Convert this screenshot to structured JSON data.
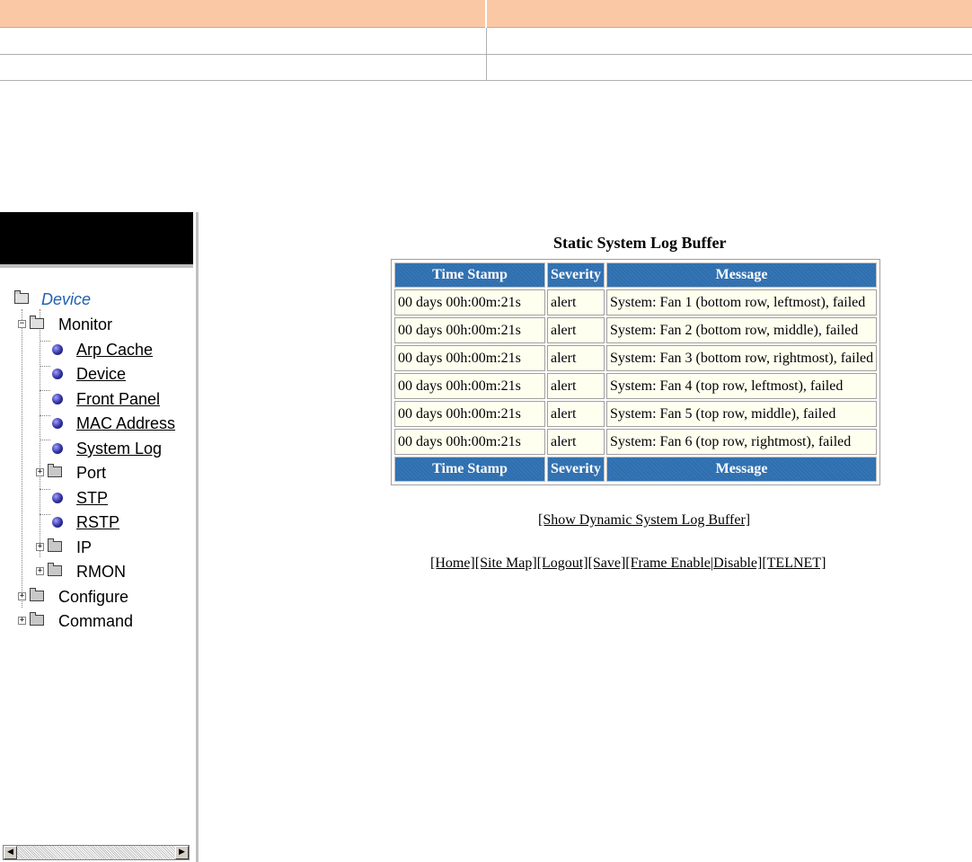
{
  "doc_table": {
    "rows": 3
  },
  "sidebar": {
    "tree": [
      {
        "label": "Device",
        "kind": "root"
      },
      {
        "label": "Monitor",
        "kind": "folder-open"
      },
      {
        "label": "Arp Cache",
        "kind": "leaf"
      },
      {
        "label": "Device",
        "kind": "leaf"
      },
      {
        "label": "Front Panel",
        "kind": "leaf"
      },
      {
        "label": "MAC Address",
        "kind": "leaf"
      },
      {
        "label": "System Log",
        "kind": "leaf"
      },
      {
        "label": "Port",
        "kind": "folder"
      },
      {
        "label": "STP",
        "kind": "leaf"
      },
      {
        "label": "RSTP",
        "kind": "leaf"
      },
      {
        "label": "IP",
        "kind": "folder"
      },
      {
        "label": "RMON",
        "kind": "folder"
      },
      {
        "label": "Configure",
        "kind": "folder"
      },
      {
        "label": "Command",
        "kind": "folder"
      }
    ]
  },
  "log": {
    "title": "Static System Log Buffer",
    "columns": [
      "Time Stamp",
      "Severity",
      "Message"
    ],
    "rows": [
      {
        "time": "00 days 00h:00m:21s",
        "severity": "alert",
        "message": "System: Fan 1 (bottom row, leftmost), failed"
      },
      {
        "time": "00 days 00h:00m:21s",
        "severity": "alert",
        "message": "System: Fan 2 (bottom row, middle), failed"
      },
      {
        "time": "00 days 00h:00m:21s",
        "severity": "alert",
        "message": "System: Fan 3 (bottom row, rightmost), failed"
      },
      {
        "time": "00 days 00h:00m:21s",
        "severity": "alert",
        "message": "System: Fan 4 (top row, leftmost), failed"
      },
      {
        "time": "00 days 00h:00m:21s",
        "severity": "alert",
        "message": "System: Fan 5 (top row, middle), failed"
      },
      {
        "time": "00 days 00h:00m:21s",
        "severity": "alert",
        "message": "System: Fan 6 (top row, rightmost), failed"
      }
    ]
  },
  "links": {
    "dynamic": "[Show Dynamic System Log Buffer]",
    "home": "[Home]",
    "site_map": "[Site Map]",
    "logout": "[Logout]",
    "save": "[Save]",
    "frame_enable": "[Frame Enable",
    "separator": "|",
    "disable": "Disable]",
    "telnet": "[TELNET]"
  },
  "colors": {
    "header_band": "#fbc8a6",
    "table_header": "#2e6fb0",
    "cell_bg": "#fffff0"
  }
}
